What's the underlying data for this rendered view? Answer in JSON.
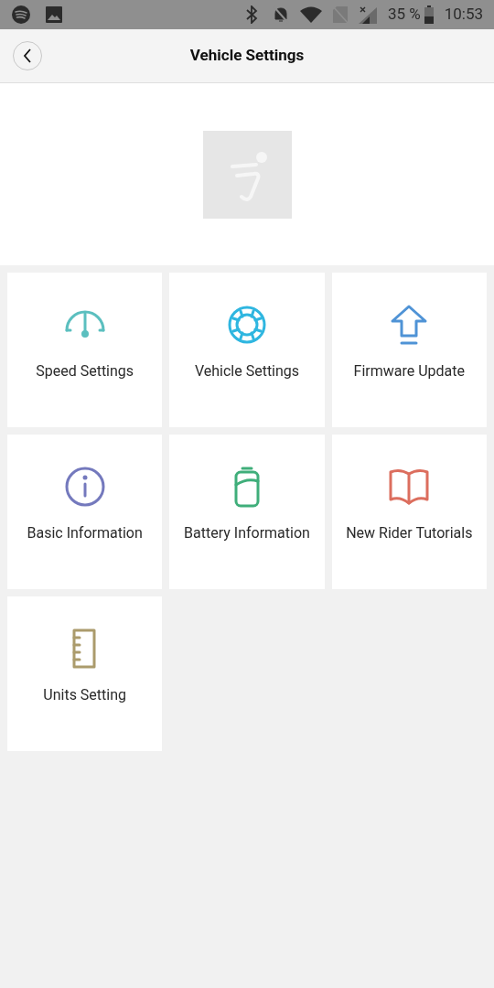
{
  "status_bar": {
    "battery": "35 %",
    "time": "10:53"
  },
  "header": {
    "title": "Vehicle Settings"
  },
  "menu": [
    {
      "label": "Speed Settings",
      "color": "#5bbfbf"
    },
    {
      "label": "Vehicle Settings",
      "color": "#2fb6e0"
    },
    {
      "label": "Firmware Update",
      "color": "#4f93d6"
    },
    {
      "label": "Basic Information",
      "color": "#7479bd"
    },
    {
      "label": "Battery Information",
      "color": "#3fae7a"
    },
    {
      "label": "New Rider Tutorials",
      "color": "#dc6e5e"
    },
    {
      "label": "Units Setting",
      "color": "#ab9b6c"
    }
  ]
}
